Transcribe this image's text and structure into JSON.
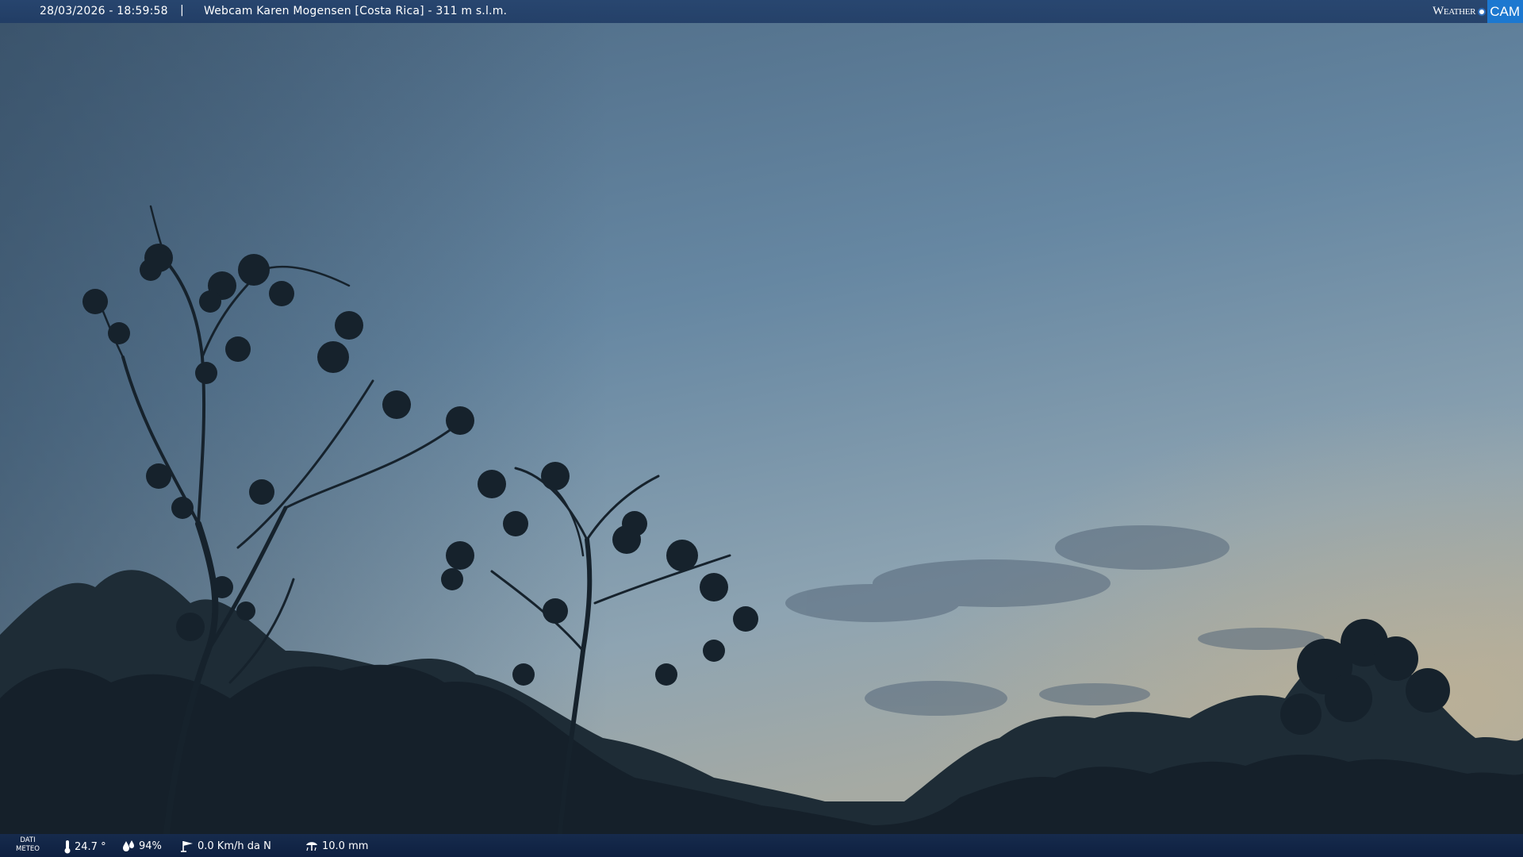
{
  "header": {
    "timestamp": "28/03/2026 - 18:59:58",
    "separator": "|",
    "title": "Webcam Karen Mogensen [Costa Rica]  - 311 m s.l.m."
  },
  "brand": {
    "word": "Weather",
    "cam": "CAM"
  },
  "footer": {
    "label_line1": "DATI",
    "label_line2": "METEO",
    "temperature": "24.7 °",
    "humidity": "94%",
    "wind": "0.0 Km/h da N",
    "rain": "10.0 mm"
  },
  "colors": {
    "sky_top": "#4a6882",
    "sky_mid": "#6a8aa4",
    "sky_horizon": "#9aa6a8",
    "foliage": "#1a2630",
    "bar": "#26446e"
  },
  "icons": {
    "temperature": "thermometer-icon",
    "humidity": "humidity-drops-icon",
    "wind": "wind-vane-icon",
    "rain": "rain-gauge-icon"
  }
}
